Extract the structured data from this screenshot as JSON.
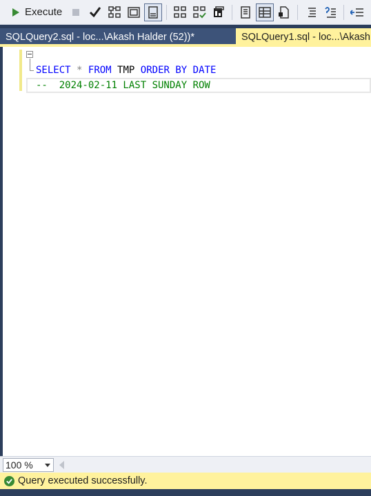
{
  "toolbar": {
    "execute_label": "Execute",
    "icons": [
      "execute-play-icon",
      "stop-icon",
      "parse-check-icon",
      "estimated-plan-icon",
      "query-designer-icon",
      "results-to-grid-toggle-icon",
      "include-plan-icon",
      "live-stats-icon",
      "client-stats-icon",
      "results-to-text-icon",
      "results-to-grid-icon",
      "results-to-file-icon",
      "comment-icon",
      "uncomment-icon",
      "outdent-icon"
    ]
  },
  "tabs": [
    {
      "label": "SQLQuery2.sql - loc...\\Akash Halder (52))*",
      "active": false
    },
    {
      "label": "SQLQuery1.sql - loc...\\Akash",
      "active": true
    }
  ],
  "editor": {
    "line1": {
      "k1": "SELECT",
      "op": "*",
      "k2": "FROM",
      "ident": "TMP",
      "k3": "ORDER BY",
      "k4": "DATE"
    },
    "line2": {
      "comment": "--  2024-02-11 LAST SUNDAY ROW"
    }
  },
  "zoom": {
    "value": "100 %"
  },
  "status": {
    "text": "Query executed successfully."
  },
  "colors": {
    "accent_yellow": "#fff29d",
    "chrome_blue": "#2c3e5c",
    "keyword": "#0000ff",
    "comment": "#008000"
  }
}
